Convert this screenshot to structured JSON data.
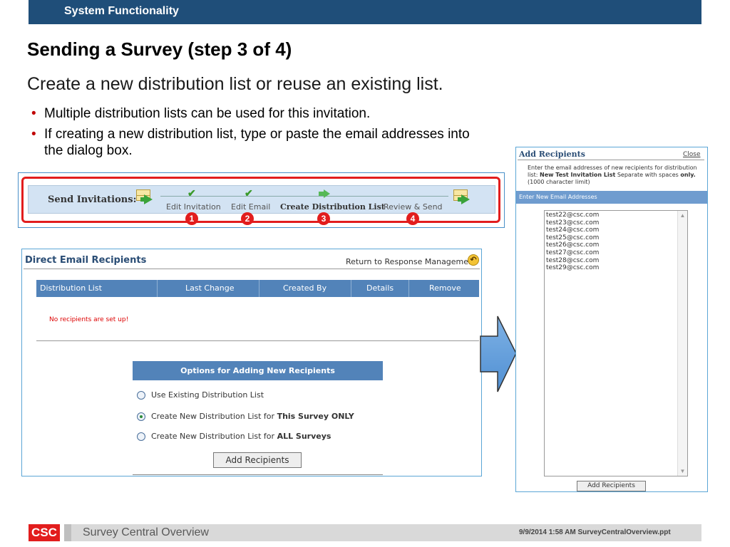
{
  "header": {
    "section": "System Functionality"
  },
  "slide": {
    "title": "Sending a Survey (step 3 of 4)",
    "subtitle": "Create a new distribution list or reuse an existing list.",
    "bullets": [
      "Multiple distribution lists can be used for this invitation.",
      "If creating a new distribution list, type or paste the email addresses into the dialog box."
    ]
  },
  "steps": {
    "label": "Send Invitations:",
    "items": [
      {
        "label": "Edit Invitation",
        "number": "1",
        "state": "done"
      },
      {
        "label": "Edit Email",
        "number": "2",
        "state": "done"
      },
      {
        "label": "Create Distribution List",
        "number": "3",
        "state": "current"
      },
      {
        "label": "Review & Send",
        "number": "4",
        "state": "pending"
      }
    ],
    "colors": {
      "highlight": "#e21d1d",
      "check": "#3a9a2a"
    }
  },
  "recipients_panel": {
    "title": "Direct Email Recipients",
    "return_link": "Return to Response Management",
    "columns": [
      "Distribution List",
      "Last Change",
      "Created By",
      "Details",
      "Remove"
    ],
    "empty_message": "No recipients are set up!",
    "options_header": "Options for Adding New Recipients",
    "options": [
      {
        "prefix": "Use Existing Distribution List",
        "emph": "",
        "checked": false
      },
      {
        "prefix": "Create New Distribution List for ",
        "emph": "This Survey ONLY",
        "checked": true
      },
      {
        "prefix": "Create New Distribution List for ",
        "emph": "ALL Surveys",
        "checked": false
      }
    ],
    "add_button": "Add Recipients",
    "header_color": "#5283b9"
  },
  "dialog": {
    "title": "Add Recipients",
    "close": "Close",
    "instr_1": "Enter the email addresses of new recipients for distribution list: ",
    "list_name": "New Test Invitation List",
    "instr_2": " Separate with spaces ",
    "only": "only.",
    "instr_3": " (1000 character limit)",
    "band": "Enter New Email Addresses",
    "emails": [
      "test22@csc.com",
      "test23@csc.com",
      "test24@csc.com",
      "test25@csc.com",
      "test26@csc.com",
      "test27@csc.com",
      "test28@csc.com",
      "test29@csc.com"
    ],
    "button": "Add Recipients"
  },
  "footer": {
    "logo": "CSC",
    "title": "Survey Central Overview",
    "meta": "9/9/2014 1:58 AM   SurveyCentralOverview.ppt",
    "brand_color": "#e21d1d"
  }
}
